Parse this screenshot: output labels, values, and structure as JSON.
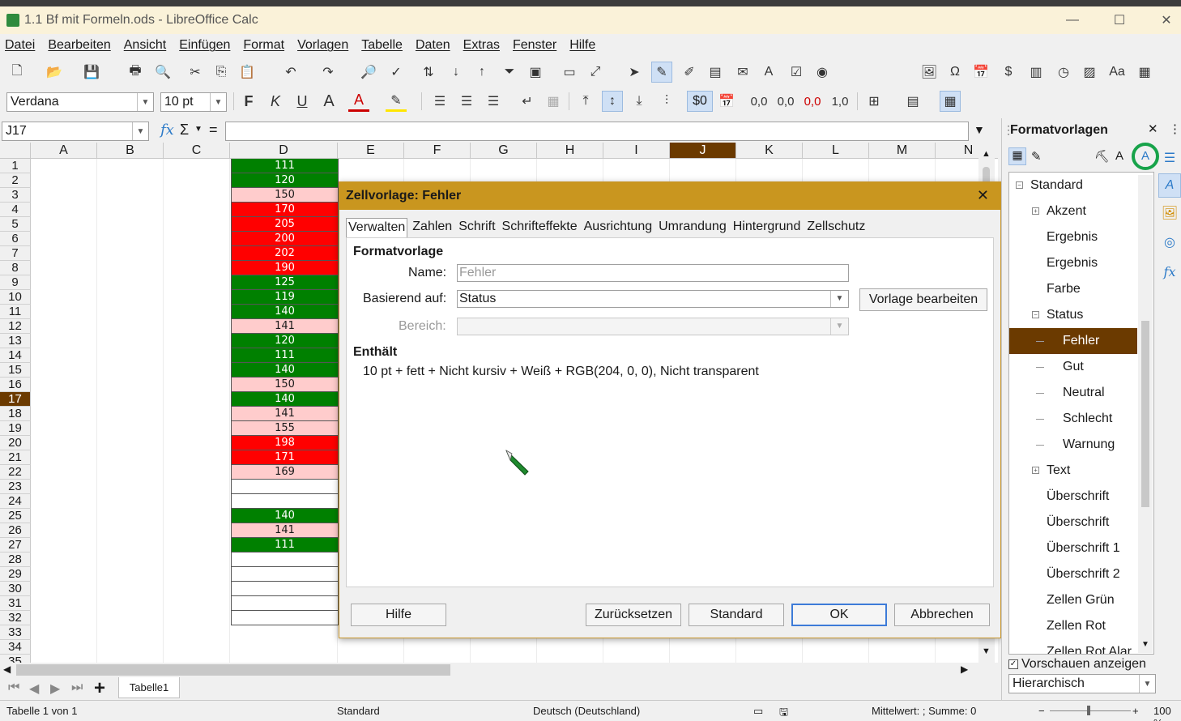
{
  "window": {
    "title": "1.1 Bf mit Formeln.ods - LibreOffice Calc",
    "min": "—",
    "max": "☐",
    "close": "✕"
  },
  "menu": [
    "Datei",
    "Bearbeiten",
    "Ansicht",
    "Einfügen",
    "Format",
    "Vorlagen",
    "Tabelle",
    "Daten",
    "Extras",
    "Fenster",
    "Hilfe"
  ],
  "font": {
    "name": "Verdana",
    "size": "10 pt"
  },
  "toolbar2_labels": {
    "bold": "F",
    "italic": "K",
    "underline": "U",
    "currency": "$0",
    "decimals1": "0,0",
    "decimals2": "0,0",
    "decimals3": "0,0",
    "decimals4": "1,0"
  },
  "formula": {
    "namebox": "J17",
    "fx": "fx",
    "sum": "Σ",
    "eq": "="
  },
  "columns": [
    "A",
    "B",
    "C",
    "D",
    "E",
    "F",
    "G",
    "H",
    "I",
    "J",
    "K",
    "L",
    "M",
    "N"
  ],
  "selected_column": "J",
  "rows": [
    "1",
    "2",
    "3",
    "4",
    "5",
    "6",
    "7",
    "8",
    "9",
    "10",
    "11",
    "12",
    "13",
    "14",
    "15",
    "16",
    "17",
    "18",
    "19",
    "20",
    "21",
    "22",
    "23",
    "24",
    "25",
    "26",
    "27",
    "28",
    "29",
    "30",
    "31",
    "32",
    "33",
    "34",
    "35"
  ],
  "selected_row": "17",
  "colors": {
    "green": "#008000",
    "lightred": "#ffcccc",
    "red": "#ff0000",
    "white": "#ffffff",
    "accent": "#6b3a00",
    "dialog_title": "#c9961f",
    "annot": "#17a34a"
  },
  "column_d": [
    {
      "v": "111",
      "s": "green"
    },
    {
      "v": "120",
      "s": "green"
    },
    {
      "v": "150",
      "s": "lightred"
    },
    {
      "v": "170",
      "s": "red"
    },
    {
      "v": "205",
      "s": "red"
    },
    {
      "v": "200",
      "s": "red"
    },
    {
      "v": "202",
      "s": "red"
    },
    {
      "v": "190",
      "s": "red"
    },
    {
      "v": "125",
      "s": "green"
    },
    {
      "v": "119",
      "s": "green"
    },
    {
      "v": "140",
      "s": "green"
    },
    {
      "v": "141",
      "s": "lightred"
    },
    {
      "v": "120",
      "s": "green"
    },
    {
      "v": "111",
      "s": "green"
    },
    {
      "v": "140",
      "s": "green"
    },
    {
      "v": "150",
      "s": "lightred"
    },
    {
      "v": "140",
      "s": "green"
    },
    {
      "v": "141",
      "s": "lightred"
    },
    {
      "v": "155",
      "s": "lightred"
    },
    {
      "v": "198",
      "s": "red"
    },
    {
      "v": "171",
      "s": "red"
    },
    {
      "v": "169",
      "s": "lightred"
    },
    {
      "v": "",
      "s": "white"
    },
    {
      "v": "",
      "s": "white"
    },
    {
      "v": "140",
      "s": "green"
    },
    {
      "v": "141",
      "s": "lightred"
    },
    {
      "v": "111",
      "s": "green"
    },
    {
      "v": "",
      "s": "white"
    },
    {
      "v": "",
      "s": "white"
    },
    {
      "v": "",
      "s": "white"
    },
    {
      "v": "",
      "s": "white"
    },
    {
      "v": "",
      "s": "white"
    }
  ],
  "sheet_tabs": {
    "name": "Tabelle1",
    "add": "+"
  },
  "status": {
    "sheet": "Tabelle 1 von 1",
    "style": "Standard",
    "lang": "Deutsch (Deutschland)",
    "stats": "Mittelwert: ; Summe: 0",
    "zoom": "100 %"
  },
  "dialog": {
    "title": "Zellvorlage: Fehler",
    "tabs": [
      "Verwalten",
      "Zahlen",
      "Schrift",
      "Schrifteffekte",
      "Ausrichtung",
      "Umrandung",
      "Hintergrund",
      "Zellschutz"
    ],
    "section_style": "Formatvorlage",
    "name_label": "Name:",
    "name_value": "Fehler",
    "based_label": "Basierend auf:",
    "based_value": "Status",
    "edit_button": "Vorlage bearbeiten",
    "area_label": "Bereich:",
    "contains_label": "Enthält",
    "contains_value": "10 pt + fett + Nicht kursiv + Weiß + RGB(204, 0, 0), Nicht transparent",
    "buttons": {
      "help": "Hilfe",
      "reset": "Zurücksetzen",
      "standard": "Standard",
      "ok": "OK",
      "cancel": "Abbrechen"
    }
  },
  "sidebar": {
    "title": "Formatvorlagen",
    "tree": [
      {
        "label": "Standard",
        "level": 0,
        "exp": "−"
      },
      {
        "label": "Akzent",
        "level": 1,
        "exp": "+"
      },
      {
        "label": "Ergebnis",
        "level": 1,
        "exp": ""
      },
      {
        "label": "Ergebnis",
        "level": 1,
        "exp": ""
      },
      {
        "label": "Farbe",
        "level": 1,
        "exp": ""
      },
      {
        "label": "Status",
        "level": 1,
        "exp": "−"
      },
      {
        "label": "Fehler",
        "level": 2,
        "exp": "",
        "selected": true
      },
      {
        "label": "Gut",
        "level": 2,
        "exp": ""
      },
      {
        "label": "Neutral",
        "level": 2,
        "exp": ""
      },
      {
        "label": "Schlecht",
        "level": 2,
        "exp": ""
      },
      {
        "label": "Warnung",
        "level": 2,
        "exp": ""
      },
      {
        "label": "Text",
        "level": 1,
        "exp": "+"
      },
      {
        "label": "Überschrift",
        "level": 1,
        "exp": ""
      },
      {
        "label": "Überschrift",
        "level": 1,
        "exp": ""
      },
      {
        "label": "Überschrift 1",
        "level": 1,
        "exp": ""
      },
      {
        "label": "Überschrift 2",
        "level": 1,
        "exp": ""
      },
      {
        "label": "Zellen Grün",
        "level": 1,
        "exp": ""
      },
      {
        "label": "Zellen Rot",
        "level": 1,
        "exp": ""
      },
      {
        "label": "Zellen Rot Alar",
        "level": 1,
        "exp": ""
      }
    ],
    "preview_label": "Vorschauen anzeigen",
    "filter_value": "Hierarchisch"
  }
}
